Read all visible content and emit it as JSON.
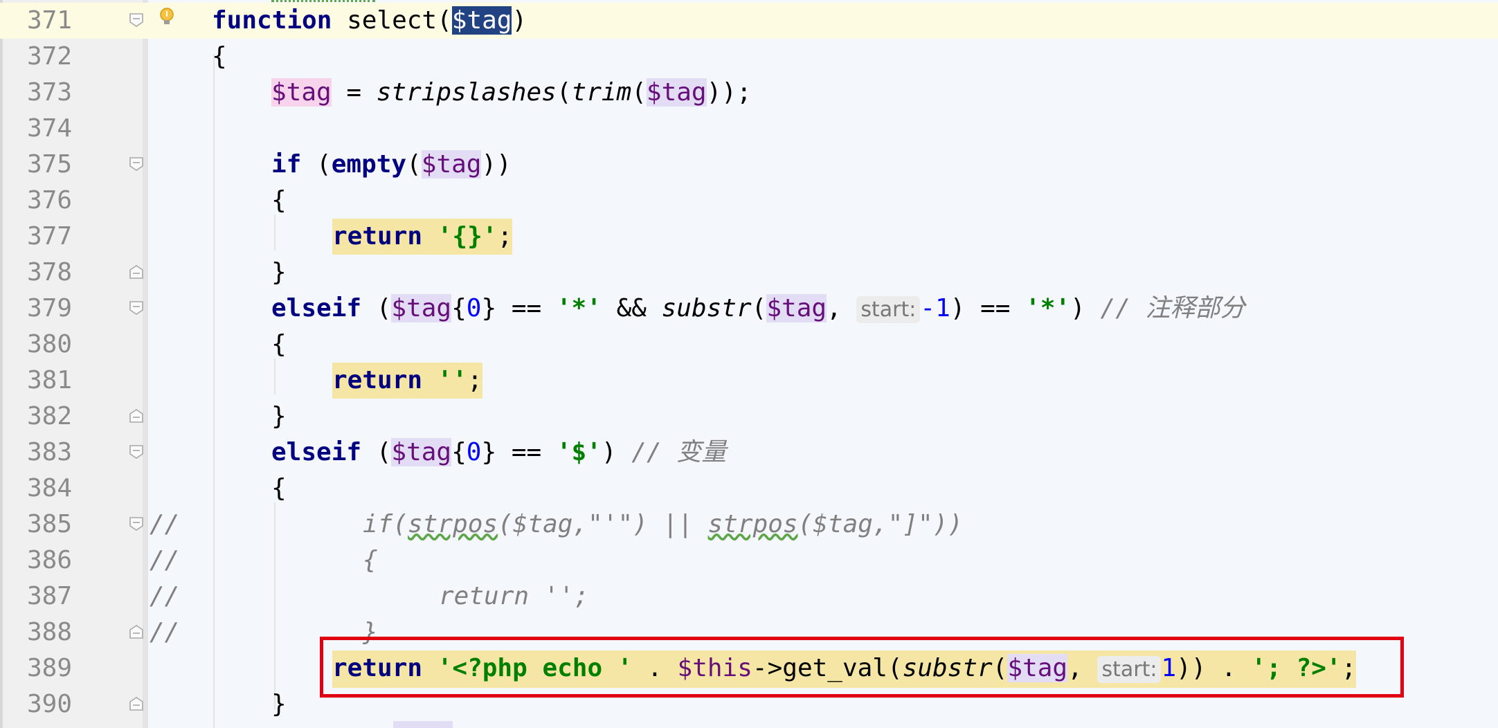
{
  "editor": {
    "language": "PHP",
    "current_line": "371",
    "lines": [
      {
        "number": "371",
        "text": "function select($tag)"
      },
      {
        "number": "372",
        "text": "{"
      },
      {
        "number": "373",
        "text": "$tag = stripslashes(trim($tag));"
      },
      {
        "number": "374",
        "text": ""
      },
      {
        "number": "375",
        "text": "if (empty($tag))"
      },
      {
        "number": "376",
        "text": "{"
      },
      {
        "number": "377",
        "text": "return '{}';"
      },
      {
        "number": "378",
        "text": "}"
      },
      {
        "number": "379",
        "text": "elseif ($tag{0} == '*' && substr($tag, start: -1) == '*') // 注释部分"
      },
      {
        "number": "380",
        "text": "{"
      },
      {
        "number": "381",
        "text": "return '';"
      },
      {
        "number": "382",
        "text": "}"
      },
      {
        "number": "383",
        "text": "elseif ($tag{0} == '$') // 变量"
      },
      {
        "number": "384",
        "text": "{"
      },
      {
        "number": "385",
        "text": "//        if(strpos($tag,\"'\") || strpos($tag,\"]\"))"
      },
      {
        "number": "386",
        "text": "//        {"
      },
      {
        "number": "387",
        "text": "//            return '';"
      },
      {
        "number": "388",
        "text": "//        }"
      },
      {
        "number": "389",
        "text": "return '<?php echo ' . $this->get_val(substr($tag, start: 1)) . '; ?>';"
      },
      {
        "number": "390",
        "text": "}"
      }
    ]
  },
  "tokens": {
    "function_kw": "function",
    "fn_name": " select(",
    "var_tag": "$tag",
    "close_paren": ")",
    "open_brace": "{",
    "close_brace": "}",
    "assign": " = ",
    "stripslashes": "stripslashes",
    "trim": "trim",
    "end_paren_semi": "));",
    "if_kw": "if",
    "space_paren": " (",
    "empty_kw": "empty",
    "paren": "(",
    "close2": "))",
    "return_kw": "return",
    "str_braces": "'{}'",
    "semi": ";",
    "elseif_kw": "elseif",
    "brace_open": "{",
    "zero": "0",
    "brace_close": "}",
    "eqeq": " == ",
    "str_star": "'*'",
    "and": " && ",
    "substr": "substr",
    "comma": ", ",
    "hint_start": "start:",
    "neg_one": "-1",
    "paren_eqeq": ") == ",
    "paren_close": ")",
    "comment_zhushi": " // 注释部分",
    "str_empty": "''",
    "str_dollar": "'$'",
    "comment_bianliang": " // 变量",
    "c385_prefix": "//",
    "c385_if": "if(",
    "c385_strpos": "strpos",
    "c385_args1": "($tag,\"'\") || ",
    "c385_args2": "($tag,\"]\"))",
    "c386": "{",
    "c387": "return '';",
    "c388": "}",
    "str_php_echo": "'<?php echo '",
    "dot": " . ",
    "this": "$this",
    "arrow": "->",
    "get_val": "get_val(",
    "one": "1",
    "str_php_close": "'; ?>'"
  },
  "colors": {
    "keyword": "#000080",
    "variable": "#660e7a",
    "string": "#008000",
    "number": "#0000ff",
    "comment": "#808080",
    "highlight_box": "#e00012",
    "current_line_bg": "#fdfbe1",
    "editor_bg": "#f4f8fd"
  },
  "icons": [
    "fold-open-icon",
    "fold-close-icon",
    "intention-bulb-icon"
  ]
}
